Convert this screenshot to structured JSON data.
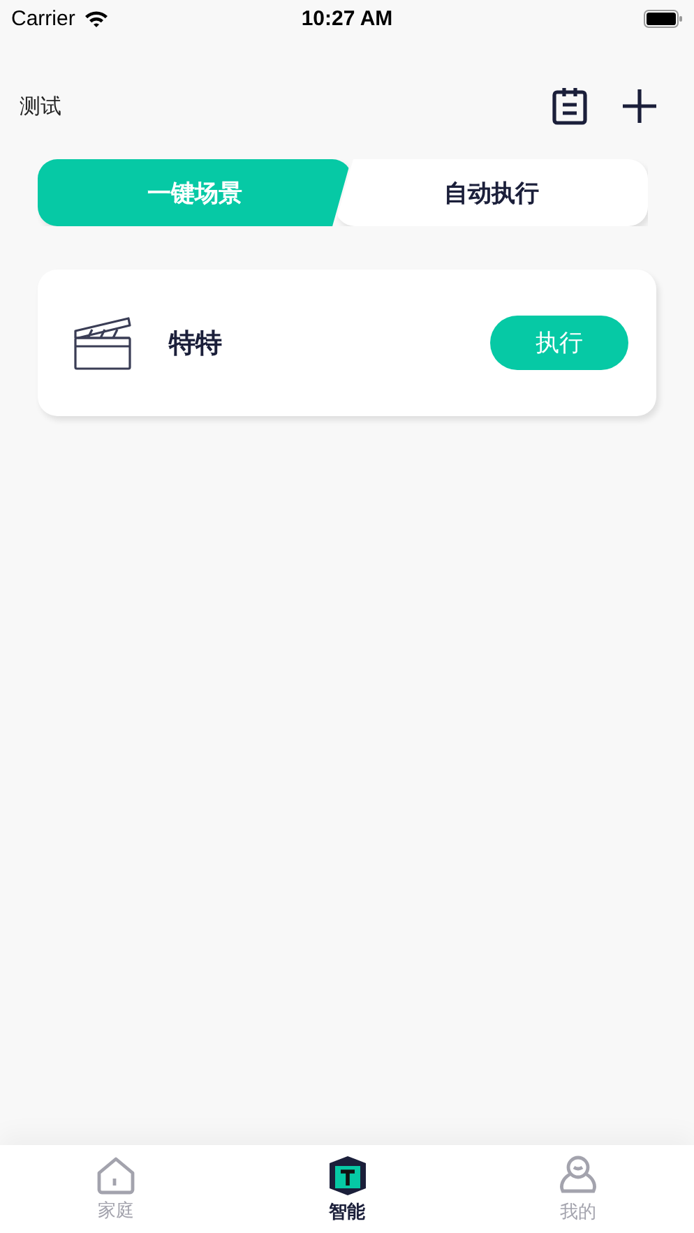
{
  "status_bar": {
    "carrier": "Carrier",
    "time": "10:27 AM"
  },
  "header": {
    "title": "测试"
  },
  "tabs": [
    {
      "label": "一键场景",
      "selected": true
    },
    {
      "label": "自动执行",
      "selected": false
    }
  ],
  "scenes": [
    {
      "name": "特特",
      "action": "执行"
    }
  ],
  "bottom_nav": [
    {
      "kind": "home",
      "label": "家庭",
      "selected": false
    },
    {
      "kind": "smart",
      "label": "智能",
      "selected": true
    },
    {
      "kind": "me",
      "label": "我的",
      "selected": false
    }
  ]
}
